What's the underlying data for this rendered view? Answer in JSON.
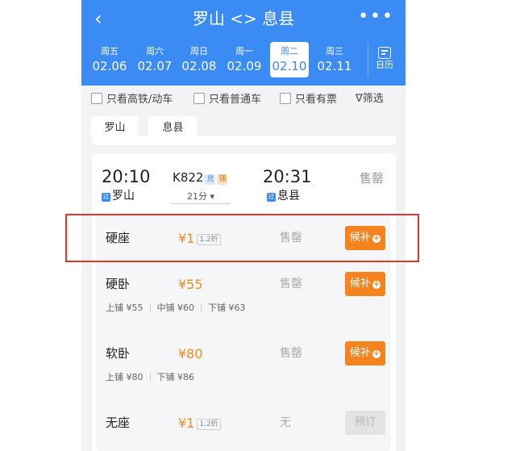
{
  "header": {
    "title": "罗山 <> 息县",
    "back_icon": "‹",
    "more_icon": "•••"
  },
  "dates": [
    {
      "weekday": "周五",
      "date": "02.06",
      "selected": false
    },
    {
      "weekday": "周六",
      "date": "02.07",
      "selected": false
    },
    {
      "weekday": "周日",
      "date": "02.08",
      "selected": false
    },
    {
      "weekday": "周一",
      "date": "02.09",
      "selected": false
    },
    {
      "weekday": "周二",
      "date": "02.10",
      "selected": true
    },
    {
      "weekday": "周三",
      "date": "02.11",
      "selected": false
    }
  ],
  "calendar_label": "日历",
  "filters": {
    "high_speed": "只看高铁/动车",
    "normal": "只看普通车",
    "available": "只看有票",
    "sift": "筛选",
    "sift_icon": "∇"
  },
  "stations": [
    "罗山",
    "息县"
  ],
  "train": {
    "departure_time": "20:10",
    "departure_station": "罗山",
    "departure_tag": "过",
    "number": "K822",
    "badge_exchange": "兑",
    "badge_berth": "铺",
    "duration": "21分",
    "duration_caret": "▾",
    "arrival_time": "20:31",
    "arrival_station": "息县",
    "arrival_tag": "过",
    "status": "售罄"
  },
  "seats": [
    {
      "name": "硬座",
      "price": "¥1",
      "discount": "1.2折",
      "availability": "售罄",
      "action": "候补",
      "action_icon": "+"
    },
    {
      "name": "硬卧",
      "price": "¥55",
      "availability": "售罄",
      "action": "候补",
      "action_icon": "+",
      "berths": [
        "上铺 ¥55",
        "中铺 ¥60",
        "下铺 ¥63"
      ]
    },
    {
      "name": "软卧",
      "price": "¥80",
      "availability": "售罄",
      "action": "候补",
      "action_icon": "+",
      "berths": [
        "上铺 ¥80",
        "下铺 ¥86"
      ]
    },
    {
      "name": "无座",
      "price": "¥1",
      "discount": "1.2折",
      "availability": "无",
      "action": "预订"
    }
  ],
  "colors": {
    "header_blue": "#3b8bf5",
    "price_orange": "#f08a1c",
    "button_orange": "#f5841f",
    "highlight_red": "#e0342c"
  }
}
